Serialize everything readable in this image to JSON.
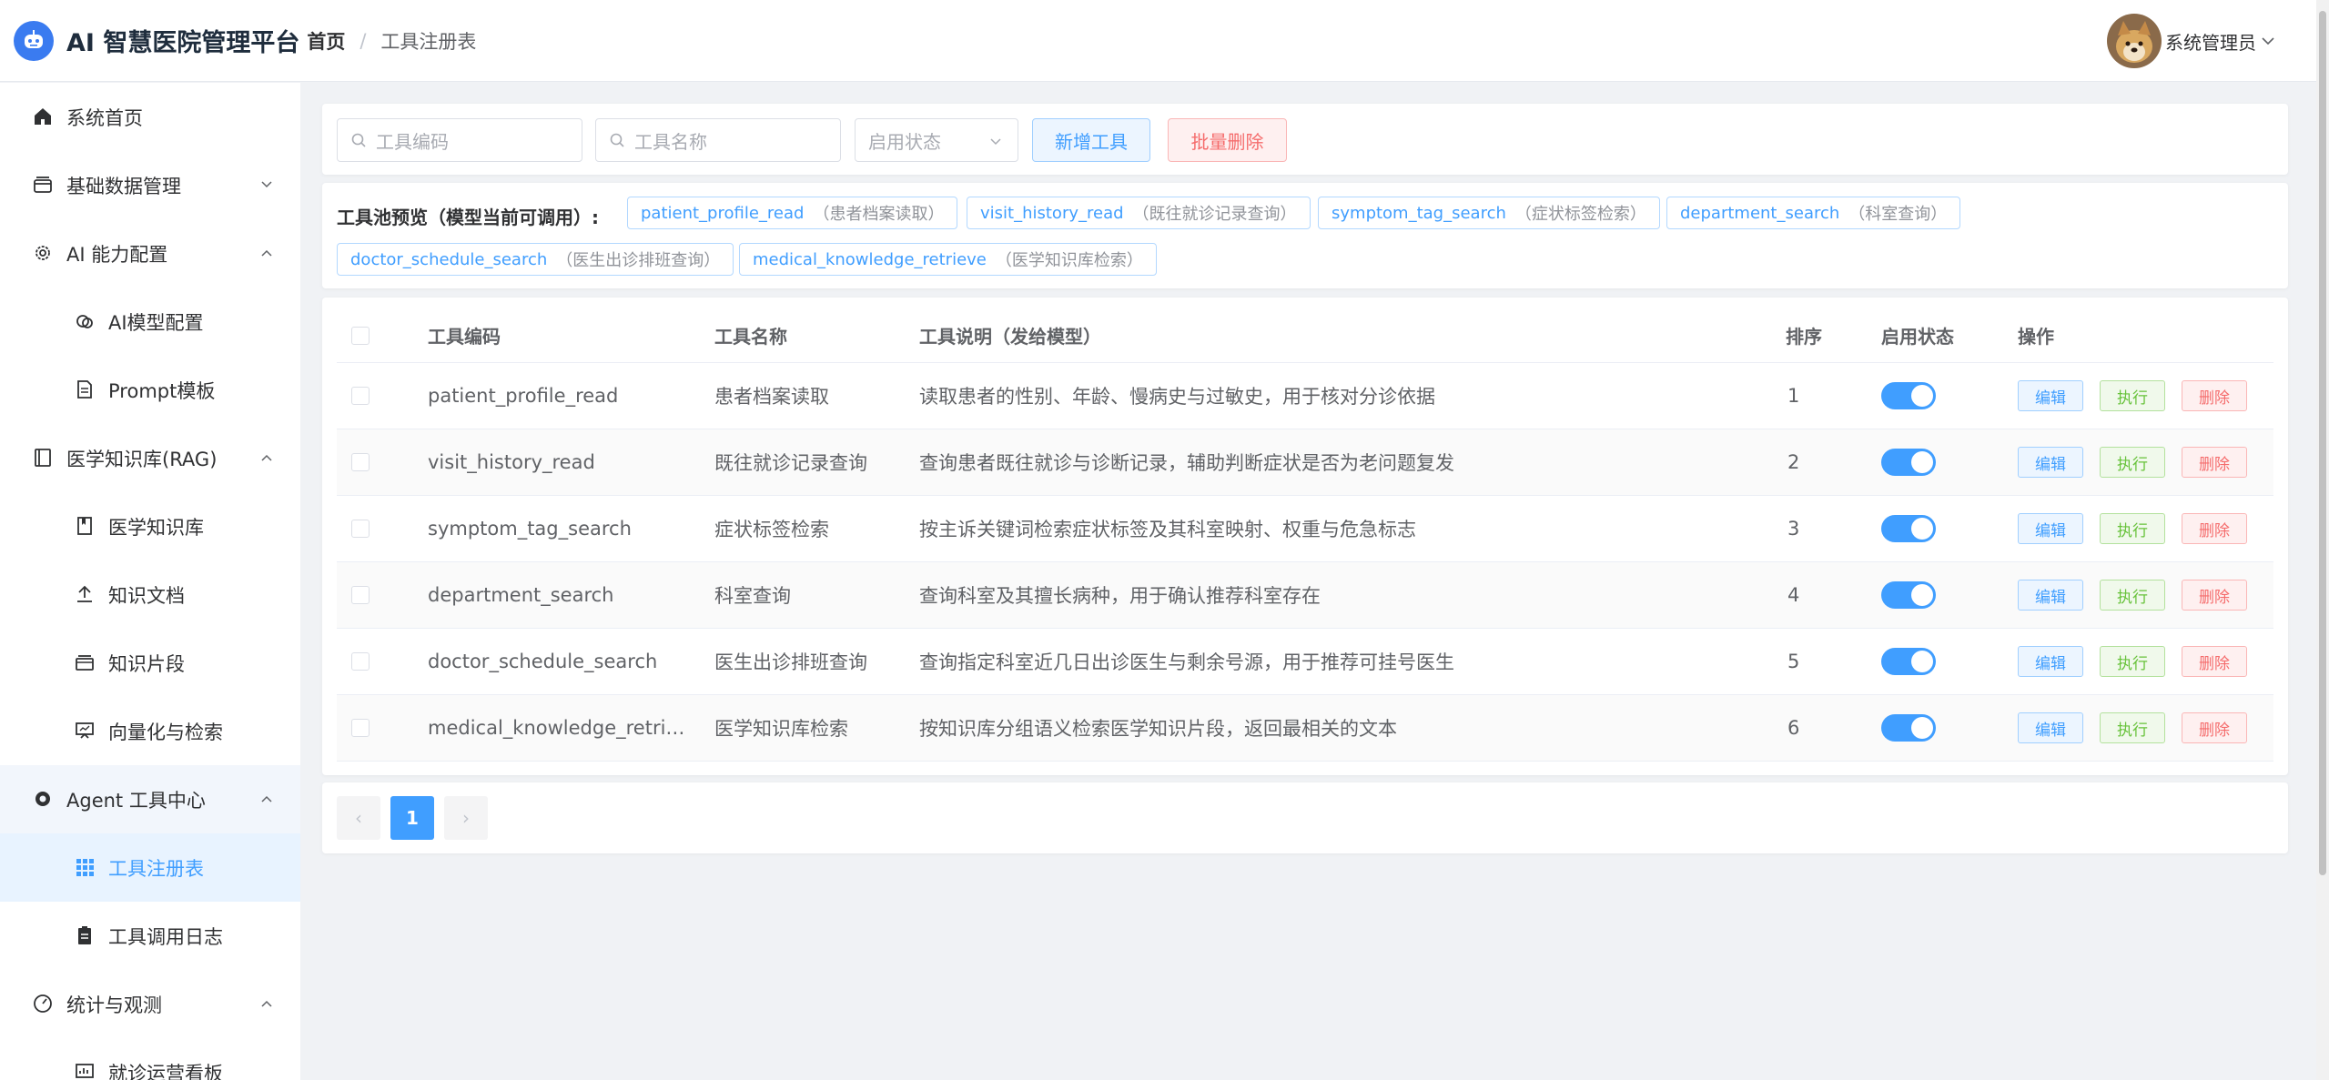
{
  "header": {
    "app_title": "AI 智慧医院管理平台",
    "breadcrumb_home": "首页",
    "breadcrumb_sep": "/",
    "breadcrumb_current": "工具注册表",
    "user_name": "系统管理员"
  },
  "sidebar": {
    "items": [
      {
        "label": "系统首页",
        "icon": "home-icon"
      },
      {
        "label": "基础数据管理",
        "icon": "database-icon"
      },
      {
        "label": "AI 能力配置",
        "icon": "gear-icon"
      },
      {
        "label": "AI模型配置",
        "icon": "model-icon"
      },
      {
        "label": "Prompt模板",
        "icon": "document-icon"
      },
      {
        "label": "医学知识库(RAG)",
        "icon": "book-icon"
      },
      {
        "label": "医学知识库",
        "icon": "library-icon"
      },
      {
        "label": "知识文档",
        "icon": "upload-icon"
      },
      {
        "label": "知识片段",
        "icon": "layers-icon"
      },
      {
        "label": "向量化与检索",
        "icon": "presentation-icon"
      },
      {
        "label": "Agent 工具中心",
        "icon": "settings-icon"
      },
      {
        "label": "工具注册表",
        "icon": "grid-icon"
      },
      {
        "label": "工具调用日志",
        "icon": "clipboard-icon"
      },
      {
        "label": "统计与观测",
        "icon": "gauge-icon"
      },
      {
        "label": "就诊运营看板",
        "icon": "dashboard-icon"
      }
    ]
  },
  "toolbar": {
    "code_placeholder": "工具编码",
    "name_placeholder": "工具名称",
    "status_placeholder": "启用状态",
    "add_label": "新增工具",
    "batch_delete_label": "批量删除"
  },
  "pool": {
    "label": "工具池预览（模型当前可调用）:",
    "tags": [
      {
        "code": "patient_profile_read",
        "name": "（患者档案读取）"
      },
      {
        "code": "visit_history_read",
        "name": "（既往就诊记录查询）"
      },
      {
        "code": "symptom_tag_search",
        "name": "（症状标签检索）"
      },
      {
        "code": "department_search",
        "name": "（科室查询）"
      },
      {
        "code": "doctor_schedule_search",
        "name": "（医生出诊排班查询）"
      },
      {
        "code": "medical_knowledge_retrieve",
        "name": "（医学知识库检索）"
      }
    ]
  },
  "table": {
    "headers": {
      "code": "工具编码",
      "name": "工具名称",
      "desc": "工具说明（发给模型）",
      "sort": "排序",
      "status": "启用状态",
      "ops": "操作"
    },
    "rows": [
      {
        "code": "patient_profile_read",
        "name": "患者档案读取",
        "desc": "读取患者的性别、年龄、慢病史与过敏史，用于核对分诊依据",
        "sort": "1",
        "enabled": true
      },
      {
        "code": "visit_history_read",
        "name": "既往就诊记录查询",
        "desc": "查询患者既往就诊与诊断记录，辅助判断症状是否为老问题复发",
        "sort": "2",
        "enabled": true
      },
      {
        "code": "symptom_tag_search",
        "name": "症状标签检索",
        "desc": "按主诉关键词检索症状标签及其科室映射、权重与危急标志",
        "sort": "3",
        "enabled": true
      },
      {
        "code": "department_search",
        "name": "科室查询",
        "desc": "查询科室及其擅长病种，用于确认推荐科室存在",
        "sort": "4",
        "enabled": true
      },
      {
        "code": "doctor_schedule_search",
        "name": "医生出诊排班查询",
        "desc": "查询指定科室近几日出诊医生与剩余号源，用于推荐可挂号医生",
        "sort": "5",
        "enabled": true
      },
      {
        "code": "medical_knowledge_retri…",
        "name": "医学知识库检索",
        "desc": "按知识库分组语义检索医学知识片段，返回最相关的文本",
        "sort": "6",
        "enabled": true
      }
    ],
    "actions": {
      "edit": "编辑",
      "exec": "执行",
      "delete": "删除"
    }
  },
  "pagination": {
    "current": "1",
    "prev": "‹",
    "next": "›"
  },
  "colors": {
    "primary": "#409eff",
    "success": "#67c23a",
    "danger": "#f56c6c",
    "active_menu_bg": "#e8f3ff"
  }
}
